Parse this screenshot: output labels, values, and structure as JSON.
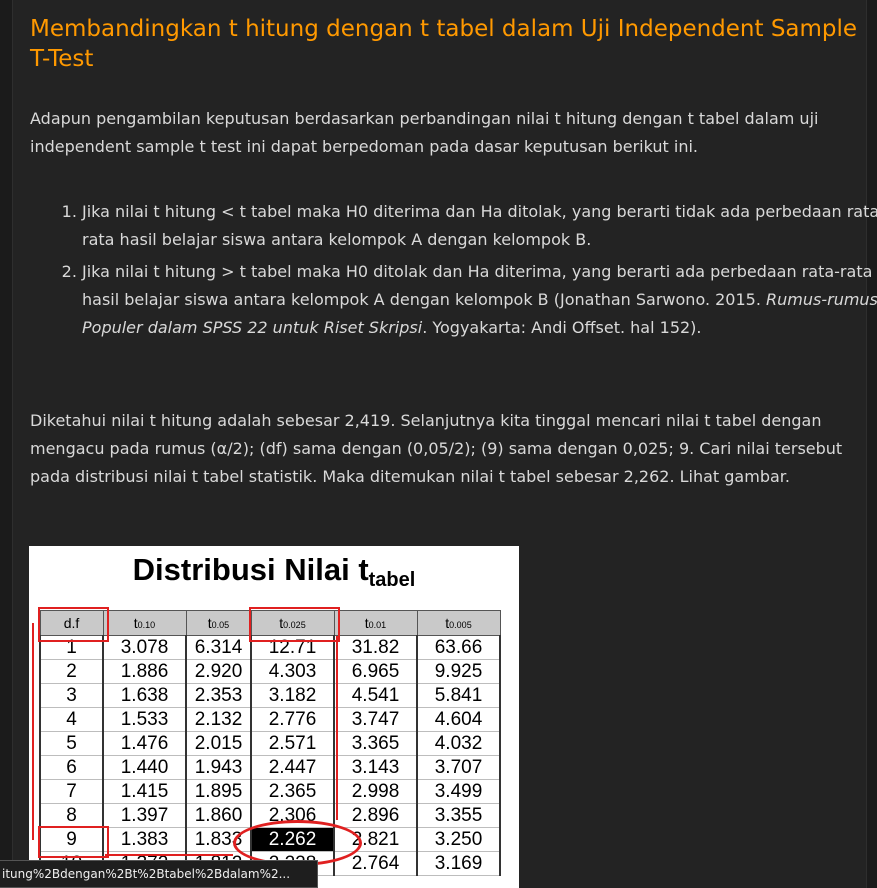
{
  "article": {
    "heading": "Membandingkan t hitung dengan t tabel dalam Uji Independent Sample T-Test",
    "intro": "Adapun pengambilan keputusan berdasarkan perbandingan nilai t hitung dengan t tabel dalam uji independent sample t test ini dapat berpedoman pada dasar keputusan berikut ini.",
    "rules": [
      {
        "text": "Jika nilai t hitung < t tabel maka H0 diterima dan Ha ditolak, yang berarti tidak ada perbedaan rata-rata hasil belajar siswa antara kelompok A dengan kelompok B."
      },
      {
        "text": "Jika nilai t hitung > t tabel maka H0 ditolak dan Ha diterima, yang berarti ada perbedaan rata-rata hasil belajar siswa antara kelompok A dengan kelompok B (Jonathan Sarwono. 2015. ",
        "book": "Rumus-rumus Populer dalam SPSS 22 untuk Riset Skripsi",
        "after": ". Yogyakarta: Andi Offset. hal 152)."
      }
    ],
    "conclusion": "Diketahui nilai t hitung adalah sebesar 2,419. Selanjutnya kita tinggal mencari nilai t tabel dengan mengacu pada rumus (α/2); (df) sama dengan (0,05/2); (9) sama dengan 0,025; 9. Cari nilai tersebut pada distribusi nilai t tabel statistik. Maka ditemukan nilai t tabel sebesar 2,262. Lihat gambar."
  },
  "figure": {
    "title_main": "Distribusi Nilai t",
    "title_sub": "tabel",
    "headers": [
      "d.f",
      "t",
      "t",
      "t",
      "t",
      "t"
    ],
    "header_subs": [
      "",
      "0.10",
      "0.05",
      "0.025",
      "0.01",
      "0.005"
    ],
    "rows": [
      [
        "1",
        "3.078",
        "6.314",
        "12.71",
        "31.82",
        "63.66"
      ],
      [
        "2",
        "1.886",
        "2.920",
        "4.303",
        "6.965",
        "9.925"
      ],
      [
        "3",
        "1.638",
        "2.353",
        "3.182",
        "4.541",
        "5.841"
      ],
      [
        "4",
        "1.533",
        "2.132",
        "2.776",
        "3.747",
        "4.604"
      ],
      [
        "5",
        "1.476",
        "2.015",
        "2.571",
        "3.365",
        "4.032"
      ],
      [
        "6",
        "1.440",
        "1.943",
        "2.447",
        "3.143",
        "3.707"
      ],
      [
        "7",
        "1.415",
        "1.895",
        "2.365",
        "2.998",
        "3.499"
      ],
      [
        "8",
        "1.397",
        "1.860",
        "2.306",
        "2.896",
        "3.355"
      ],
      [
        "9",
        "1.383",
        "1.833",
        "2.262",
        "2.821",
        "3.250"
      ],
      [
        "10",
        "1.372",
        "1.812",
        "2.228",
        "2.764",
        "3.169"
      ]
    ],
    "highlight": {
      "row": 8,
      "col": 3
    },
    "marker_color": "#e02020"
  },
  "statusbar": {
    "url": "itung%2Bdengan%2Bt%2Btabel%2Bdalam%2..."
  }
}
